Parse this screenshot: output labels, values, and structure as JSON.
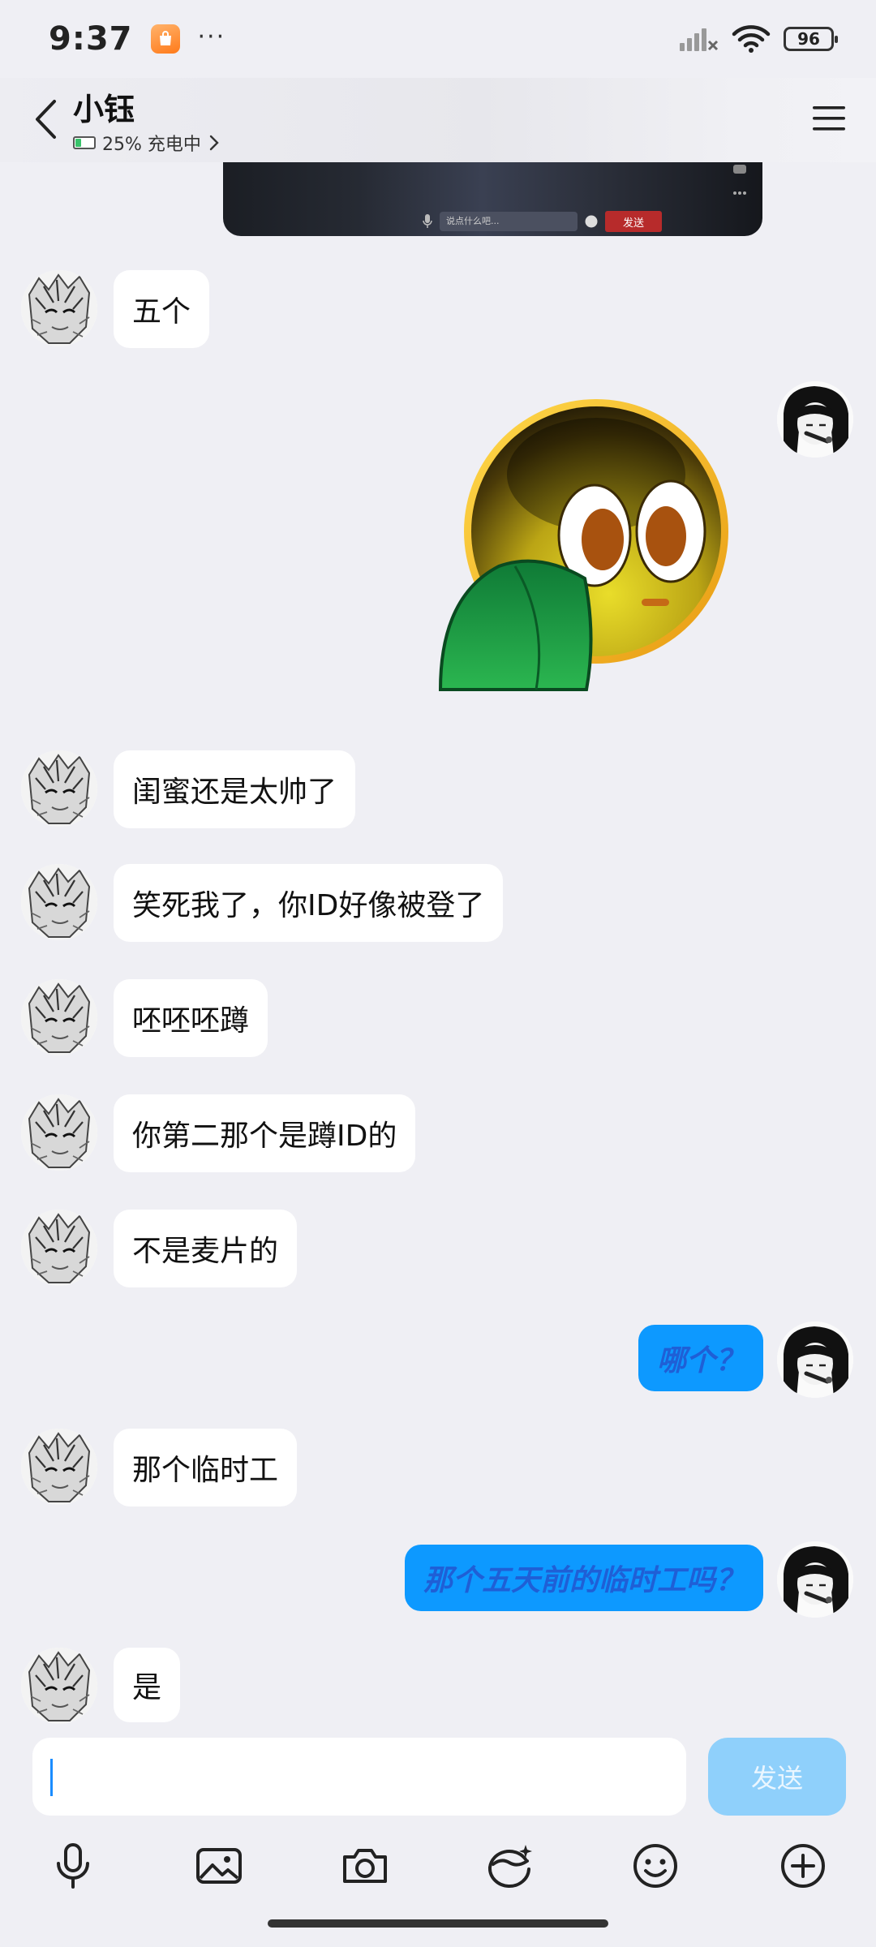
{
  "status_bar": {
    "time": "9:37",
    "dots": "···",
    "battery": "96"
  },
  "header": {
    "title": "小钰",
    "battery_status": "25% 充电中"
  },
  "video_card": {
    "input_placeholder": "说点什么吧...",
    "send_label": "发送"
  },
  "messages": [
    {
      "side": "in",
      "text": "五个"
    },
    {
      "side": "out",
      "type": "sticker",
      "icon": "shy-emoji-sticker"
    },
    {
      "side": "in",
      "text": "闺蜜还是太帅了"
    },
    {
      "side": "in",
      "text": "笑死我了，你ID好像被登了"
    },
    {
      "side": "in",
      "text": "呸呸呸蹲"
    },
    {
      "side": "in",
      "text": "你第二那个是蹲ID的"
    },
    {
      "side": "in",
      "text": "不是麦片的"
    },
    {
      "side": "out",
      "text": "哪个？"
    },
    {
      "side": "in",
      "text": "那个临时工"
    },
    {
      "side": "out",
      "text": "那个五天前的临时工吗？"
    },
    {
      "side": "in",
      "text": "是"
    }
  ],
  "composer": {
    "input_value": "",
    "send_label": "发送"
  },
  "toolbar": {
    "icons": [
      "microphone-icon",
      "image-icon",
      "camera-icon",
      "face-effect-icon",
      "emoji-icon",
      "plus-icon"
    ]
  },
  "colors": {
    "background": "#efeff4",
    "incoming_bubble": "#ffffff",
    "outgoing_bubble": "#0d99ff",
    "outgoing_text": "#1f5fd6",
    "send_button_disabled": "#8fd0fb"
  }
}
